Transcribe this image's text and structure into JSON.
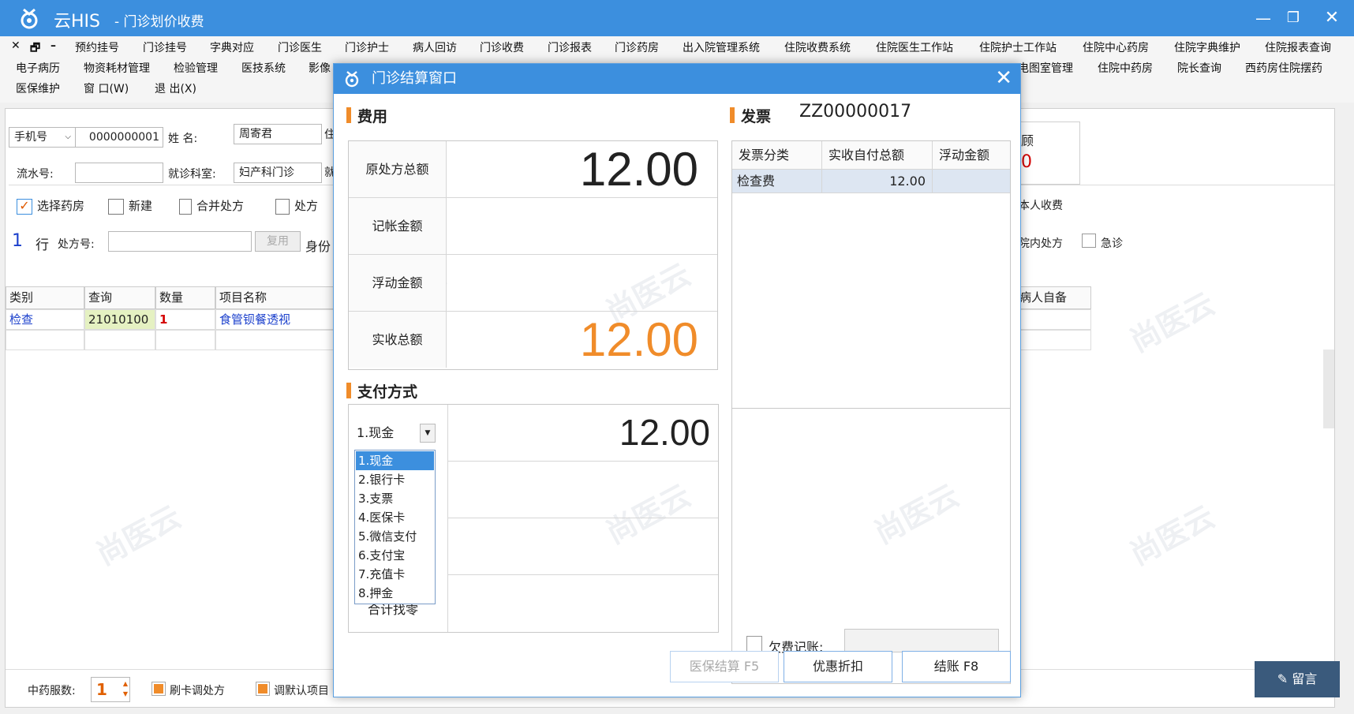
{
  "titlebar": {
    "app_name": "云HIS",
    "subtitle": "- 门诊划价收费"
  },
  "menu_row1": [
    "预约挂号",
    "门诊挂号",
    "字典对应",
    "门诊医生",
    "门诊护士",
    "病人回访",
    "门诊收费",
    "门诊报表",
    "门诊药房",
    "出入院管理系统",
    "住院收费系统",
    "住院医生工作站",
    "住院护士工作站",
    "住院中心药房",
    "住院字典维护",
    "住院报表查询"
  ],
  "menu_row2": [
    "电子病历",
    "物资耗材管理",
    "检验管理",
    "医技系统",
    "影像",
    "电图室管理",
    "住院中药房",
    "院长查询",
    "西药房住院摆药"
  ],
  "menu_row3": [
    "医保维护",
    "窗 口(W)",
    "退 出(X)"
  ],
  "form": {
    "phone_type": "手机号",
    "phone_value": "0000000001",
    "name_label": "姓    名:",
    "name_value": "周寄君",
    "serial_label": "流水号:",
    "serial_value": "",
    "dept_label": "就诊科室:",
    "dept_value": "妇产科门诊",
    "partial_label_1": "住",
    "partial_label_2": "就"
  },
  "toolbar": {
    "select_pharmacy": "选择药房",
    "new": "新建",
    "merge": "合并处方",
    "rx": "处方"
  },
  "rx_line": {
    "row_count": "1",
    "row_label": "行",
    "rx_no_label": "处方号:",
    "copy": "复用",
    "id_label": "身份"
  },
  "grid": {
    "headers": [
      "类别",
      "查询",
      "数量",
      "项目名称"
    ],
    "row": {
      "category": "检查",
      "query": "21010100",
      "qty": "1",
      "item": "食管钡餐透视"
    },
    "right_header": "病人自备"
  },
  "right_panel": {
    "fee_digit": "0",
    "title_char": "顾",
    "self_pay": "本人收费",
    "in_hospital_rx": "院内处方",
    "emergency": "急诊"
  },
  "bottom": {
    "herb_doses_label": "中药服数:",
    "herb_doses": "1",
    "card_rx": "刷卡调处方",
    "default_item": "调默认项目"
  },
  "message_button": "留言",
  "watermark": "尚医云",
  "dialog": {
    "title": "门诊结算窗口",
    "fee_section": "费用",
    "fees": [
      {
        "label": "原处方总额",
        "value": "12.00"
      },
      {
        "label": "记帐金额",
        "value": ""
      },
      {
        "label": "浮动金额",
        "value": ""
      },
      {
        "label": "实收总额",
        "value": "12.00"
      }
    ],
    "invoice_section": "发票",
    "invoice_no": "ZZ00000017",
    "invoice_headers": [
      "发票分类",
      "实收自付总额",
      "浮动金额"
    ],
    "invoice_row": {
      "category": "检查费",
      "amount": "12.00",
      "float": ""
    },
    "payment_section": "支付方式",
    "payment_selected": "1.现金",
    "payment_amount": "12.00",
    "payment_options": [
      "1.现金",
      "2.银行卡",
      "3.支票",
      "4.医保卡",
      "5.微信支付",
      "6.支付宝",
      "7.充值卡",
      "8.押金"
    ],
    "change_label": "合计找零",
    "arrears_label": "欠费记账:",
    "buttons": {
      "insurance": "医保结算 F5",
      "discount": "优惠折扣",
      "settle": "结账 F8"
    }
  },
  "colors": {
    "title_blue": "#3c8fde",
    "accent_orange": "#f08c2a",
    "paid_orange": "#f08c2a",
    "link_blue": "#1a3fcc",
    "qty_red": "#d40000"
  }
}
